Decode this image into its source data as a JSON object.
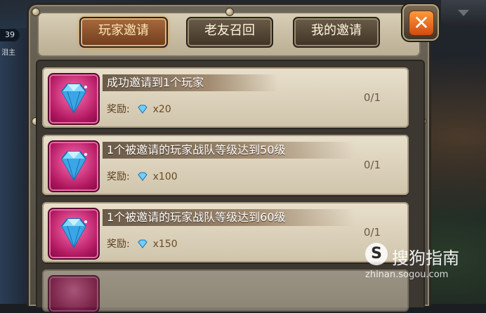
{
  "background": {
    "left_badge": "39",
    "left_side_text": "泪主"
  },
  "tabs": [
    {
      "label": "玩家邀请",
      "active": true
    },
    {
      "label": "老友召回",
      "active": false
    },
    {
      "label": "我的邀请",
      "active": false
    }
  ],
  "close_icon": "close-icon",
  "rows": [
    {
      "title": "成功邀请到1个玩家",
      "reward_label": "奖励:",
      "reward_amount": "x20",
      "progress": "0/1",
      "icon": "diamond-icon"
    },
    {
      "title": "1个被邀请的玩家战队等级达到50级",
      "reward_label": "奖励:",
      "reward_amount": "x100",
      "progress": "0/1",
      "icon": "diamond-icon"
    },
    {
      "title": "1个被邀请的玩家战队等级达到60级",
      "reward_label": "奖励:",
      "reward_amount": "x150",
      "progress": "0/1",
      "icon": "diamond-icon"
    }
  ],
  "colors": {
    "active_tab": "#8a5129",
    "close_button": "#e4651e",
    "icon_bg": "#c81f70"
  },
  "watermark": {
    "logo": "S",
    "text": "搜狗指南",
    "url": "zhinan.sogou.com"
  }
}
